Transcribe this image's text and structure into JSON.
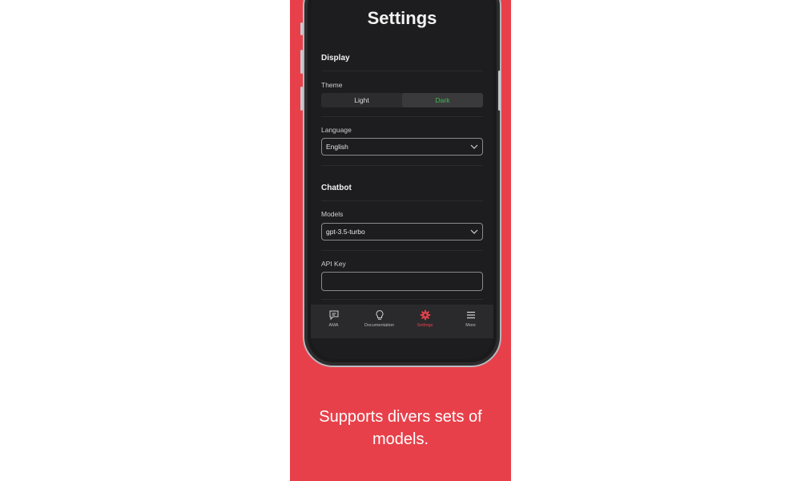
{
  "screen": {
    "title": "Settings",
    "display": {
      "heading": "Display",
      "theme_label": "Theme",
      "theme_options": [
        "Light",
        "Dark"
      ],
      "theme_selected": "Dark",
      "language_label": "Language",
      "language_value": "English"
    },
    "chatbot": {
      "heading": "Chatbot",
      "models_label": "Models",
      "models_value": "gpt-3.5-turbo",
      "api_key_label": "API Key",
      "api_key_value": ""
    },
    "tabs": [
      {
        "label": "AMA",
        "icon": "chat-icon"
      },
      {
        "label": "Documentation",
        "icon": "lightbulb-icon"
      },
      {
        "label": "Settings",
        "icon": "gear-icon",
        "active": true
      },
      {
        "label": "More",
        "icon": "menu-icon"
      }
    ]
  },
  "caption": "Supports divers sets of models.",
  "colors": {
    "background": "#e8404a",
    "accent": "#e8404a",
    "selected_text": "#3fb950"
  }
}
